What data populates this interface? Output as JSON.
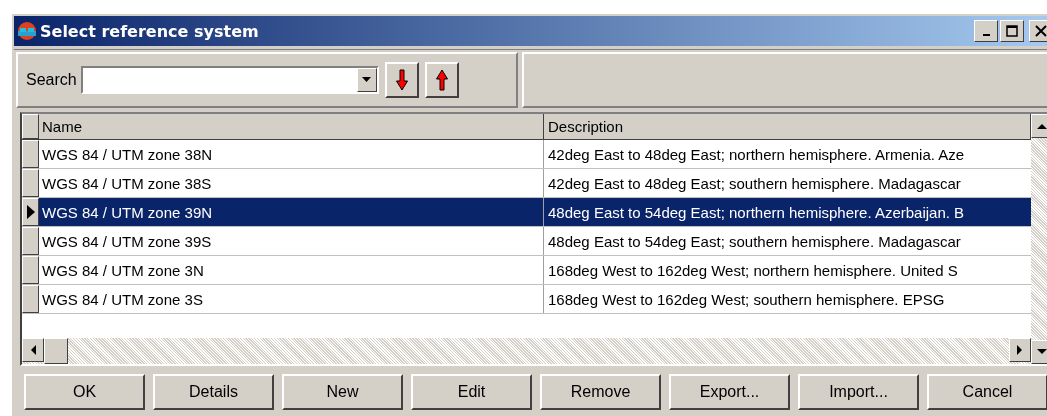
{
  "window": {
    "title": "Select reference system"
  },
  "search": {
    "label": "Search"
  },
  "table": {
    "columns": [
      "Name",
      "Description"
    ],
    "rows": [
      {
        "name": "WGS 84 / UTM zone 38N",
        "description": "42deg East to 48deg East; northern hemisphere. Armenia. Aze",
        "selected": false
      },
      {
        "name": "WGS 84 / UTM zone 38S",
        "description": "42deg East to 48deg East; southern hemisphere. Madagascar",
        "selected": false
      },
      {
        "name": "WGS 84 / UTM zone 39N",
        "description": "48deg East to 54deg East; northern hemisphere. Azerbaijan. B",
        "selected": true
      },
      {
        "name": "WGS 84 / UTM zone 39S",
        "description": "48deg East to 54deg East; southern hemisphere. Madagascar",
        "selected": false
      },
      {
        "name": "WGS 84 / UTM zone 3N",
        "description": "168deg West to 162deg West; northern hemisphere. United S",
        "selected": false
      },
      {
        "name": "WGS 84 / UTM zone 3S",
        "description": "168deg West to 162deg West; southern hemisphere. EPSG",
        "selected": false
      }
    ]
  },
  "buttons": [
    "OK",
    "Details",
    "New",
    "Edit",
    "Remove",
    "Export...",
    "Import...",
    "Cancel"
  ]
}
